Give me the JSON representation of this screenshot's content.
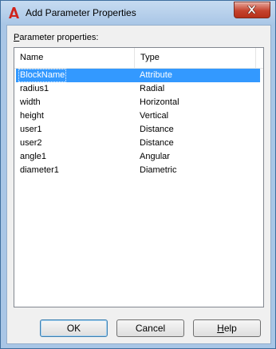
{
  "window": {
    "title": "Add Parameter Properties"
  },
  "group": {
    "label_underlined": "P",
    "label_rest": "arameter properties:"
  },
  "table": {
    "columns": [
      "Name",
      "Type"
    ],
    "rows": [
      {
        "name": "BlockName",
        "type": "Attribute",
        "selected": true
      },
      {
        "name": "radius1",
        "type": "Radial"
      },
      {
        "name": "width",
        "type": "Horizontal"
      },
      {
        "name": "height",
        "type": "Vertical"
      },
      {
        "name": "user1",
        "type": "Distance"
      },
      {
        "name": "user2",
        "type": "Distance"
      },
      {
        "name": "angle1",
        "type": "Angular"
      },
      {
        "name": "diameter1",
        "type": "Diametric"
      }
    ]
  },
  "buttons": {
    "ok": "OK",
    "cancel": "Cancel",
    "help_underlined": "H",
    "help_rest": "elp"
  },
  "colors": {
    "selection": "#3399ff",
    "titlebar": "#a9c6e6",
    "close": "#c5432e"
  },
  "icons": {
    "app": "autocad-icon",
    "close": "close-icon"
  }
}
